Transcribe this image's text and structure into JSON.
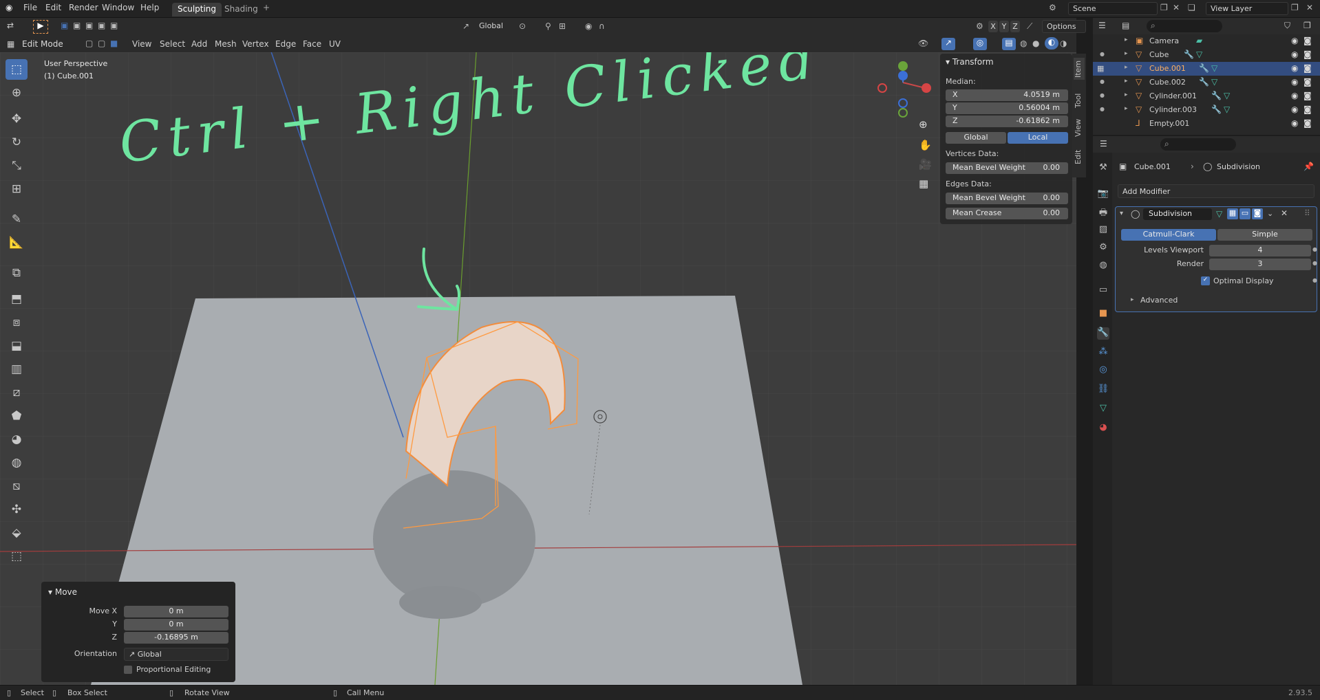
{
  "topbar": {
    "menus": [
      "File",
      "Edit",
      "Render",
      "Window",
      "Help"
    ],
    "workspaces": [
      "Sculpting",
      "Shading"
    ],
    "add_workspace": "+",
    "scene": "Scene",
    "view_layer": "View Layer"
  },
  "viewport_header": {
    "mode": "Edit Mode",
    "menus": [
      "View",
      "Select",
      "Add",
      "Mesh",
      "Vertex",
      "Edge",
      "Face",
      "UV"
    ],
    "orientation": "Global",
    "axes": [
      "X",
      "Y",
      "Z"
    ],
    "options": "Options"
  },
  "viewport": {
    "perspective": "User Perspective",
    "object": "(1) Cube.001",
    "annotation": "Ctrl + Right Clicked"
  },
  "transform_panel": {
    "title": "Transform",
    "median_label": "Median:",
    "x_label": "X",
    "x": "4.0519 m",
    "y_label": "Y",
    "y": "0.56004 m",
    "z_label": "Z",
    "z": "-0.61862 m",
    "global": "Global",
    "local": "Local",
    "vertices_data": "Vertices Data:",
    "vertex_bevel_label": "Mean Bevel Weight",
    "vertex_bevel": "0.00",
    "edges_data": "Edges Data:",
    "edge_bevel_label": "Mean Bevel Weight",
    "edge_bevel": "0.00",
    "crease_label": "Mean Crease",
    "crease": "0.00"
  },
  "side_tabs": [
    "Item",
    "Tool",
    "View",
    "Edit"
  ],
  "move_panel": {
    "title": "Move",
    "move_x_label": "Move X",
    "move_x": "0 m",
    "y_label": "Y",
    "y": "0 m",
    "z_label": "Z",
    "z": "-0.16895 m",
    "orientation_label": "Orientation",
    "orientation": "Global",
    "proportional": "Proportional Editing"
  },
  "outliner": {
    "items": [
      {
        "label": "Camera",
        "selected": false
      },
      {
        "label": "Cube",
        "selected": false
      },
      {
        "label": "Cube.001",
        "selected": true
      },
      {
        "label": "Cube.002",
        "selected": false
      },
      {
        "label": "Cylinder.001",
        "selected": false
      },
      {
        "label": "Cylinder.003",
        "selected": false
      },
      {
        "label": "Empty.001",
        "selected": false
      }
    ]
  },
  "properties": {
    "object": "Cube.001",
    "modifier_path": "Subdivision",
    "add_modifier": "Add Modifier",
    "modifier_name": "Subdivision",
    "catmull": "Catmull-Clark",
    "simple": "Simple",
    "levels_label": "Levels Viewport",
    "levels": "4",
    "render_label": "Render",
    "render": "3",
    "optimal": "Optimal Display",
    "advanced": "Advanced"
  },
  "statusbar": {
    "select": "Select",
    "box_select": "Box Select",
    "rotate": "Rotate View",
    "call_menu": "Call Menu",
    "version": "2.93.5"
  },
  "colors": {
    "accent": "#4772b3",
    "selection": "#e69650",
    "annotation": "#6ee5a0",
    "modifier": "#4cc0a8"
  }
}
